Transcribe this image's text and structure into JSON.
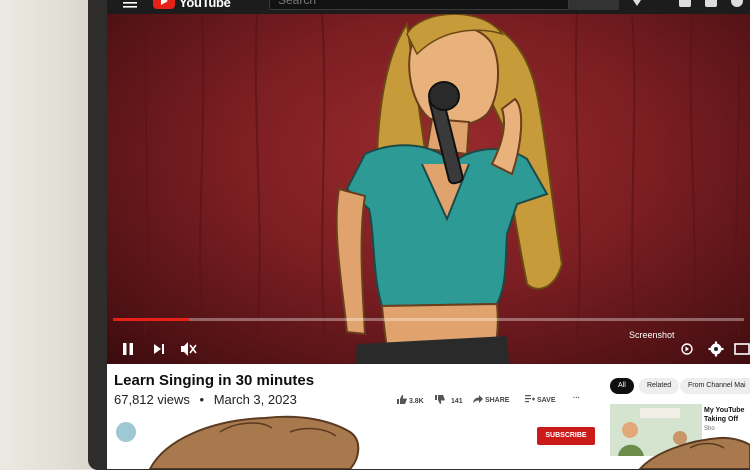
{
  "app": {
    "logo_text": "YouTube"
  },
  "search": {
    "placeholder": "Search"
  },
  "player": {
    "progress_fraction": 0.12,
    "screenshot_label": "Screenshot",
    "icons": [
      "pause-icon",
      "next-icon",
      "mute-icon",
      "screenshot-icon",
      "settings-icon",
      "theater-icon"
    ]
  },
  "video_info": {
    "title": "Learn Singing in 30 minutes",
    "views": "67,812 views",
    "date": "March 3, 2023",
    "separator": "•",
    "likes": "3.8K",
    "dislikes": "141",
    "share_label": "SHARE",
    "save_label": "SAVE",
    "more_label": "···",
    "subscribe_label": "SUBSCRIBE"
  },
  "chips": [
    {
      "label": "All",
      "active": true
    },
    {
      "label": "Related",
      "active": false
    },
    {
      "label": "From Channel Mai",
      "active": false
    }
  ],
  "recommendation": {
    "title": "My YouTube Taking Off",
    "channel": "Sho"
  },
  "colors": {
    "brand_red": "#e62117",
    "subscribe_red": "#cc1a1a",
    "curtain": "#7b1e22"
  }
}
